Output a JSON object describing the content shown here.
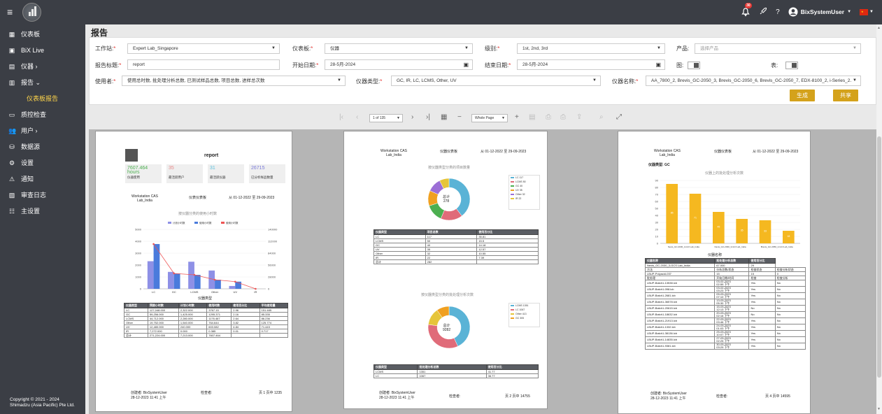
{
  "topbar": {
    "user": "BixSystemUser",
    "notifications": "30",
    "help": "?"
  },
  "sidebar": {
    "items": [
      {
        "label": "仪表板",
        "icon": "dashboard-icon",
        "glyph": "▦"
      },
      {
        "label": "BiX Live",
        "icon": "live-icon",
        "glyph": "▣"
      },
      {
        "label": "仪器 ›",
        "icon": "instrument-icon",
        "glyph": "▤"
      },
      {
        "label": "报告 ⌄",
        "icon": "report-icon",
        "glyph": "▥"
      },
      {
        "label": "仪表板报告",
        "icon": "",
        "glyph": ""
      },
      {
        "label": "质控检查",
        "icon": "qc-icon",
        "glyph": "▭"
      },
      {
        "label": "用户 ›",
        "icon": "users-icon",
        "glyph": "👥"
      },
      {
        "label": "数据源",
        "icon": "database-icon",
        "glyph": "⛁"
      },
      {
        "label": "设置",
        "icon": "gear-icon",
        "glyph": "⚙"
      },
      {
        "label": "通知",
        "icon": "warning-icon",
        "glyph": "⚠"
      },
      {
        "label": "审查日志",
        "icon": "audit-icon",
        "glyph": "▨"
      },
      {
        "label": "主设置",
        "icon": "master-settings-icon",
        "glyph": "☷"
      }
    ],
    "copyright_line1": "Copyright © 2021 - 2024",
    "copyright_line2": "Shimadzu (Asia Pacific) Pte Ltd."
  },
  "page": {
    "title": "报告"
  },
  "form": {
    "workstation_label": "工作站:",
    "workstation_value": "Expert Lab_Singapore",
    "dashboard_label": "仪表板:",
    "dashboard_value": "仪器",
    "level_label": "级别:",
    "level_value": "1st, 2nd, 3rd",
    "product_label": "产品:",
    "product_placeholder": "选择产品",
    "report_title_label": "报告标题:",
    "report_title_value": "report",
    "start_date_label": "开始日期:",
    "start_date_value": "28-5月-2024",
    "end_date_label": "结束日期:",
    "end_date_value": "28-5月-2024",
    "chart_label": "图:",
    "table_label": "表:",
    "usage_label": "使用者:",
    "usage_value": "使用总时数, 批处理分析总数, 已测试样品总数, 项目总数, 进样总次数",
    "type_label": "仪器类型:",
    "type_value": "GC, IR, LC, LCMS, Other, UV",
    "name_label": "仪器名称:",
    "name_value": "AA_7800_2, Brevis_GC-2050_3, Brevis_GC-2050_6, Brevis_GC-2050_7, EDX-8100_2, i-Series_2…",
    "generate_button": "生成",
    "share_button": "共享"
  },
  "viewer": {
    "page_input": "1 of 135",
    "zoom": "Whole Page"
  },
  "pages": [
    {
      "header": "report",
      "workstation": "Workstation CAS\nLab_India",
      "dash": "仪表仪表板",
      "range": "从 01-12-2022 至 29-09-2023",
      "kpis": [
        {
          "value": "7607.464\nhours",
          "label": "仪器使用",
          "color": "#4caf50"
        },
        {
          "value": "35",
          "label": "最活跃用户",
          "color": "#e88a8a"
        },
        {
          "value": "31",
          "label": "最活跃仪器",
          "color": "#5bc0de"
        },
        {
          "value": "26715",
          "label": "已分析样品数量",
          "color": "#7a7ad9"
        }
      ],
      "chart_title": "按仪器分类的使用小时数",
      "xaxis_label": "仪器类型",
      "legend": [
        "计划小时数",
        "使用小时数",
        "使用小时数"
      ],
      "table_headers": [
        "仪器类型",
        "预期小时数",
        "计划小时数",
        "使用时数",
        "使用百分比",
        "平均使用量"
      ],
      "table_rows": [
        [
          "LC",
          "127,048.000",
          "2,322.000",
          "3767.15",
          "2.96",
          "151.485"
        ],
        [
          "GC",
          "59,256.000",
          "1,425.000",
          "1295.371",
          "2.16",
          "85.335"
        ],
        [
          "LCMS",
          "44,712.000",
          "2,280.000",
          "1176.467",
          "2.64",
          "86.236"
        ],
        [
          "Other",
          "19,752.000",
          "1,540.000",
          "764.644",
          "3.82",
          "125.774"
        ],
        [
          "UV",
          "12,480.000",
          "240.000",
          "603.082",
          "4.84",
          "71.443"
        ],
        [
          "IR",
          "7,272.000",
          "0.000",
          "0.385",
          "0.01",
          "0.717"
        ],
        [
          "总计",
          "271,224.000",
          "7,213.000",
          "7607.464",
          "",
          ""
        ]
      ],
      "footer_creator": "创建者: BixSystemUser\n28-12-2023 11:41 上午",
      "footer_reviewer": "检查者:",
      "footer_page": "页 1 页中 1235"
    },
    {
      "workstation": "Workstation CAS\nLab_India",
      "dash": "仪器仪表板",
      "range": "从 01-12-2022 至 29-09-2023",
      "donut1_title": "按仪器类型分类的项目数量",
      "donut1_total": "总计\n278",
      "donut1_legend": [
        "LC 117",
        "LCMS 50",
        "GC 40",
        "UV 35",
        "Other 32",
        "IR 22"
      ],
      "table1_headers": [
        "仪器类型",
        "项目总数",
        "使用百分比"
      ],
      "table1_rows": [
        [
          "LC",
          "117",
          "35.81"
        ],
        [
          "LCMS",
          "50",
          "15.5"
        ],
        [
          "GC",
          "40",
          "14.18"
        ],
        [
          "UV",
          "35",
          "12.57"
        ],
        [
          "Other",
          "32",
          "10.55"
        ],
        [
          "IR",
          "22",
          "7.39"
        ],
        [
          "总计",
          "282",
          ""
        ]
      ],
      "donut2_title": "按仪器类型分类的批处理分析次数",
      "donut2_total": "总计\n9282",
      "donut2_legend": [
        "LCMS 1351",
        "LC 1067",
        "Other 413",
        "GC 305"
      ],
      "table2_headers": [
        "仪器类型",
        "批处理分析总数",
        "使用百分比"
      ],
      "table2_rows": [
        [
          "LCMS",
          "1351",
          "41.77"
        ],
        [
          "LC",
          "1067",
          "36.77"
        ]
      ],
      "footer_creator": "创建者: BixSystemUser\n28-12-2023 11:41 上午",
      "footer_reviewer": "检查者:",
      "footer_page": "页 2 页中 14755"
    },
    {
      "workstation": "Workstation CAS\nLab_India",
      "dash": "仪器仪表板",
      "range": "从 01-12-2022 至 29-09-2023",
      "type": "仪器类型: GC",
      "chart_title": "仪器上的批处理分析次数",
      "xaxis": "仪器名称",
      "bars": [
        85,
        71,
        45,
        35,
        33,
        18
      ],
      "categories": [
        "Nexis_GC-2030_4-GCI Lab_India",
        "Nexis_GC-2030_3-GCI Lab_India",
        "Brevis_GC-2050_2-GCI Lab_India"
      ],
      "table_headers": [
        "仪器名称",
        "批处理分析总数",
        "使用百分比"
      ],
      "table_row": [
        "Nexis_GC-2030_3-GCS Lab_India",
        "67.000",
        "29"
      ],
      "sub_headers": [
        "方法",
        "分析总数/状态",
        "检查状态",
        "检查分析状态"
      ],
      "sub_rows": [
        [
          "LBUP-Polyacid-037",
          "15",
          "15",
          "0"
        ],
        [
          "批处理",
          "开始日期/时间",
          "检查",
          "检查分析"
        ],
        [
          "LBUP-Batch1-13538.lcb",
          "03-02-2023\n02:59 下午",
          "Yes",
          "No"
        ],
        [
          "LBUP-Batch1-098.lcb",
          "03-02-2023\n03:23 下午",
          "Yes",
          "No"
        ],
        [
          "LBUP-Batch1-2681.lcb",
          "09-03-2023\n07:10 下午",
          "Yes",
          "No"
        ],
        [
          "LBUP-Batch1-36578.lcb",
          "13-03-2023\n05:30 下午",
          "Yes",
          "No"
        ],
        [
          "LBUP-Batch1-20615.lcb",
          "15-03-2023\n12:13 下午",
          "No",
          "No"
        ],
        [
          "LBUP-Batch1-18632.lcb",
          "20-03-2023\n02:16 下午",
          "No",
          "No"
        ],
        [
          "LBUP-Batch1-21913.lcb",
          "22-03-2023\n03:46 下午",
          "Yes",
          "No"
        ],
        [
          "LBUP-Batch1-1332.lcb",
          "24-03-2023\n01:03 下午",
          "Yes",
          "No"
        ],
        [
          "LBUP-Batch1-38136.lcb",
          "25-03-2023\n10:07 下午",
          "Yes",
          "No"
        ],
        [
          "LBUP-Batch1-14835.lcb",
          "27-03-2023\n02:25 下午",
          "Yes",
          "No"
        ],
        [
          "LBUP-Batch1-9381.lcb",
          "30-03-2023\n03:29 下午",
          "Yes",
          "No"
        ]
      ],
      "footer_creator": "创建者: BixSystemUser\n28-12-2023 11:41 上午",
      "footer_reviewer": "检查者:",
      "footer_page": "页 4 页中 14595"
    }
  ],
  "chart_data": [
    {
      "type": "bar",
      "title": "按仪器分类的使用小时数",
      "xlabel": "仪器类型",
      "categories": [
        "LC",
        "GC",
        "LCMS",
        "Other",
        "UV",
        "IR"
      ],
      "series": [
        {
          "name": "计划小时数",
          "values": [
            2322,
            1425,
            2280,
            1540,
            240,
            0
          ]
        },
        {
          "name": "使用小时数",
          "values": [
            3767.15,
            1295.371,
            1176.467,
            764.644,
            603.082,
            0.385
          ]
        }
      ],
      "ylim": [
        0,
        5000
      ],
      "y2lim": [
        0,
        140000
      ]
    },
    {
      "type": "pie",
      "title": "按仪器类型分类的项目数量",
      "categories": [
        "LC",
        "LCMS",
        "GC",
        "UV",
        "Other",
        "IR"
      ],
      "values": [
        117,
        50,
        40,
        35,
        32,
        22
      ]
    },
    {
      "type": "pie",
      "title": "按仪器类型分类的批处理分析次数",
      "categories": [
        "LCMS",
        "LC",
        "Other",
        "GC"
      ],
      "values": [
        1351,
        1067,
        413,
        305
      ]
    },
    {
      "type": "bar",
      "title": "仪器上的批处理分析次数",
      "xlabel": "仪器名称",
      "values": [
        85,
        71,
        45,
        35,
        33,
        18
      ],
      "ylim": [
        0,
        90
      ]
    }
  ],
  "colors": {
    "accent": "#d4a21b",
    "dark": "#3b3e45",
    "sidebar_active": "#ffd54a"
  }
}
